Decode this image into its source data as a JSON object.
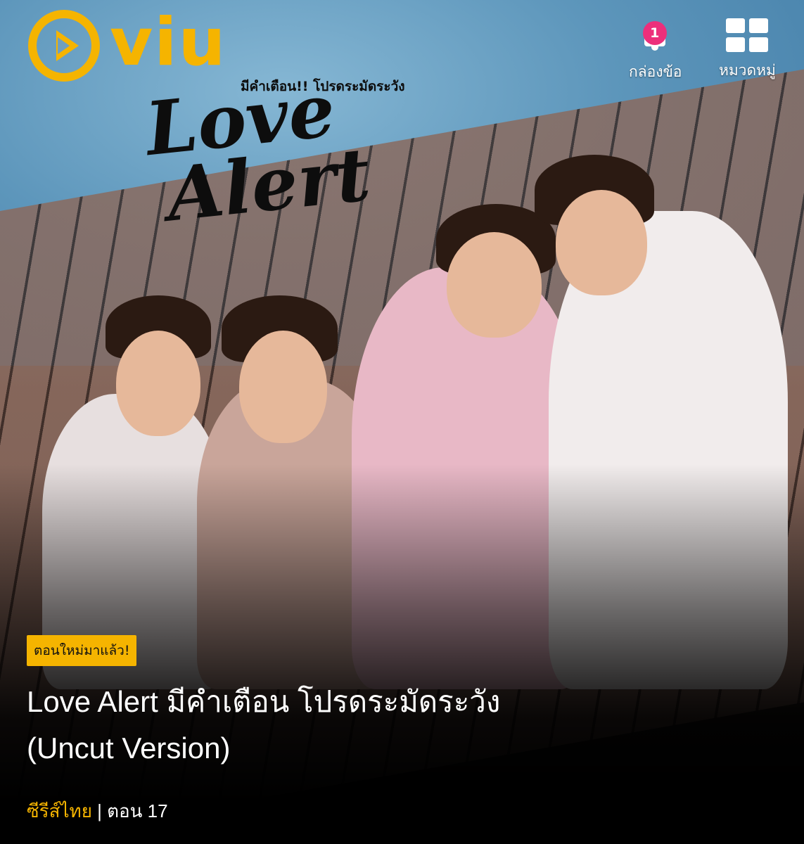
{
  "header": {
    "logo_text": "viu",
    "inbox_label": "กล่องข้อ",
    "inbox_badge": "1",
    "category_label": "หมวดหมู่"
  },
  "poster": {
    "subtitle": "มีคำเตือน!! โปรดระมัดระวัง",
    "title_line1": "Love",
    "title_line2": "Alert"
  },
  "show": {
    "tag": "ตอนใหม่มาแล้ว!",
    "title": "Love Alert มีคำเตือน โปรดระมัดระวัง (Uncut Version)",
    "category": "ซีรีส์ไทย",
    "separator": " | ",
    "episode": "ตอน 17"
  },
  "colors": {
    "brand": "#f5b400",
    "badge": "#ec2f7b"
  }
}
